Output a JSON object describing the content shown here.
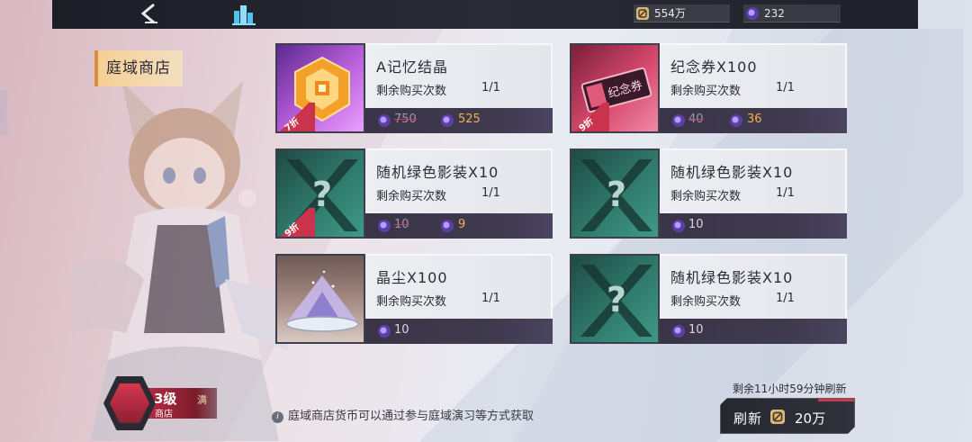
{
  "topbar": {
    "coin_value": "554万",
    "gem_value": "232",
    "back_icon": "chevron-left-icon",
    "home_icon": "city-icon"
  },
  "shop": {
    "title": "庭域商店"
  },
  "items": [
    {
      "name": "A记忆结晶",
      "remain_label": "剩余购买次数",
      "remain": "1/1",
      "old_price": "750",
      "price": "525",
      "discount": "7折",
      "thumb": "crystal"
    },
    {
      "name": "纪念券X100",
      "remain_label": "剩余购买次数",
      "remain": "1/1",
      "old_price": "40",
      "price": "36",
      "discount": "9折",
      "thumb": "ticket"
    },
    {
      "name": "随机绿色影装X10",
      "remain_label": "剩余购买次数",
      "remain": "1/1",
      "old_price": "10",
      "price": "9",
      "discount": "9折",
      "thumb": "mystery"
    },
    {
      "name": "随机绿色影装X10",
      "remain_label": "剩余购买次数",
      "remain": "1/1",
      "price": "10",
      "thumb": "mystery"
    },
    {
      "name": "晶尘X100",
      "remain_label": "剩余购买次数",
      "remain": "1/1",
      "price": "10",
      "thumb": "dust"
    },
    {
      "name": "随机绿色影装X10",
      "remain_label": "剩余购买次数",
      "remain": "1/1",
      "price": "10",
      "thumb": "mystery"
    }
  ],
  "ticket_text": "纪念券",
  "footer": {
    "hint": "庭域商店货币可以通过参与庭域演习等方式获取",
    "refresh_timer": "剩余11小时59分钟刷新",
    "refresh_label": "刷新",
    "refresh_cost": "20万"
  },
  "level": {
    "level_text": "3级",
    "sub_text": "商店",
    "max_text": "满"
  },
  "colors": {
    "accent_red": "#d2364e",
    "price_gold": "#f2b24a",
    "title_bg": "#f6cf95",
    "gem_purple": "#7b4fd6"
  }
}
